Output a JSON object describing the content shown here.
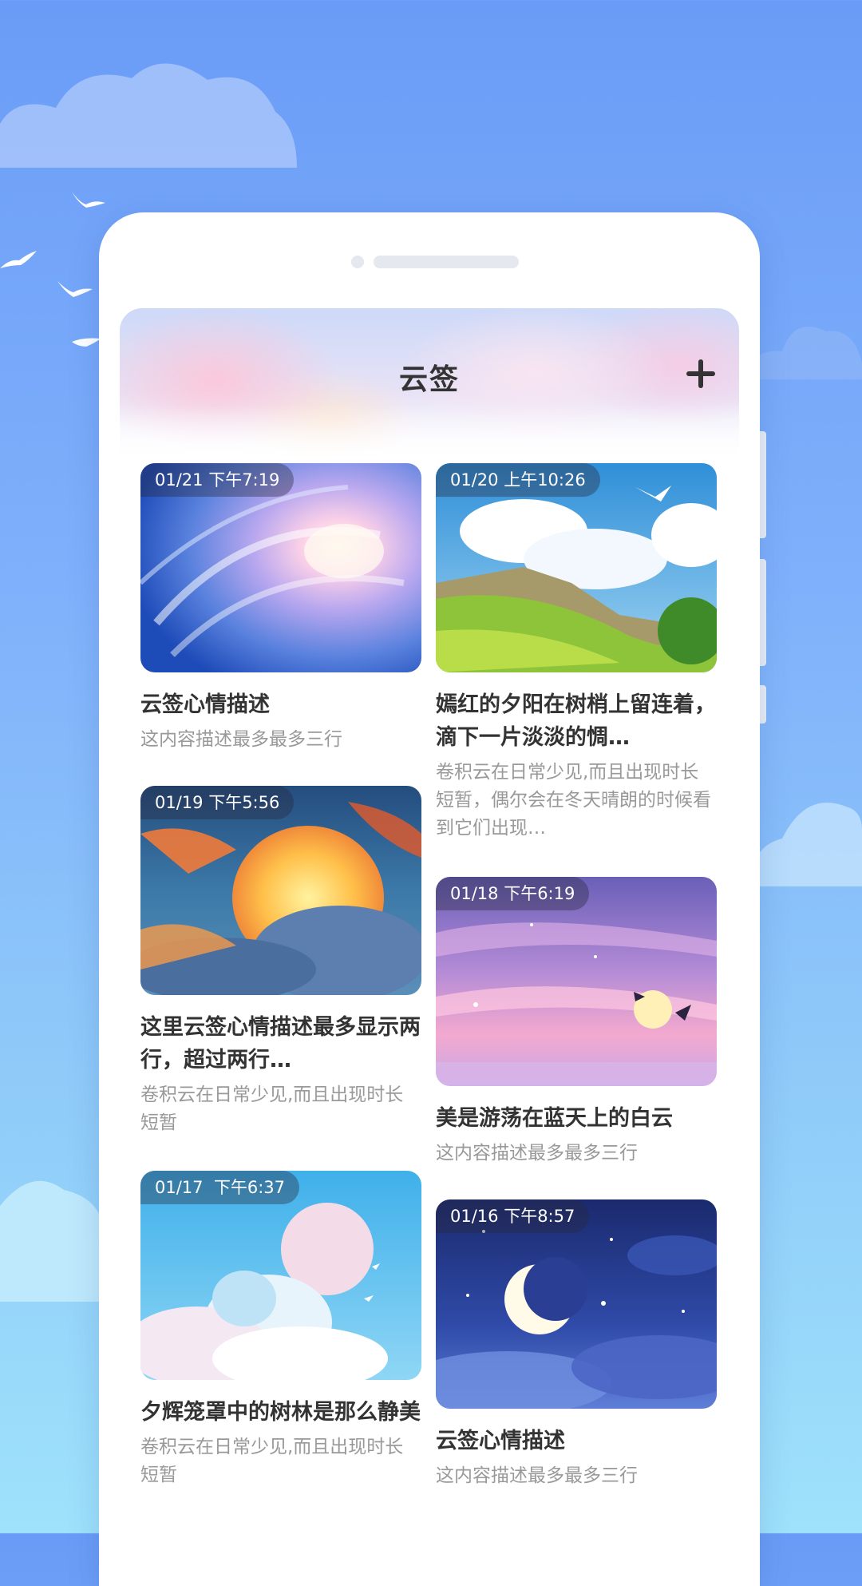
{
  "app": {
    "title": "云签"
  },
  "header": {
    "add_icon": "plus-icon"
  },
  "notes": [
    {
      "date": "01/21 下午7:19",
      "title": "云签心情描述",
      "desc": "这内容描述最多最多三行",
      "image": "swirl-sky"
    },
    {
      "date": "01/20 上午10:26",
      "title": "嫣红的夕阳在树梢上留连着，滴下一片淡淡的惆…",
      "desc": "卷积云在日常少见,而且出现时长短暂，偶尔会在冬天晴朗的时候看到它们出现…",
      "image": "green-valley"
    },
    {
      "date": "01/19 下午5:56",
      "title": "这里云签心情描述最多显示两行，超过两行…",
      "desc": "卷积云在日常少见,而且出现时长短暂",
      "image": "sunset-clouds"
    },
    {
      "date": "01/18 下午6:19",
      "title": "美是游荡在蓝天上的白云",
      "desc": "这内容描述最多最多三行",
      "image": "pink-sunset"
    },
    {
      "date": "01/17  下午6:37",
      "title": "夕辉笼罩中的树林是那么静美",
      "desc": "卷积云在日常少见,而且出现时长短暂",
      "image": "moon-clouds"
    },
    {
      "date": "01/16 下午8:57",
      "title": "云签心情描述",
      "desc": "这内容描述最多最多三行",
      "image": "night-moon"
    }
  ],
  "colors": {
    "sky": "#6a9cf7",
    "card": "#ffffff",
    "title_text": "#333333",
    "desc_text": "#999999"
  }
}
